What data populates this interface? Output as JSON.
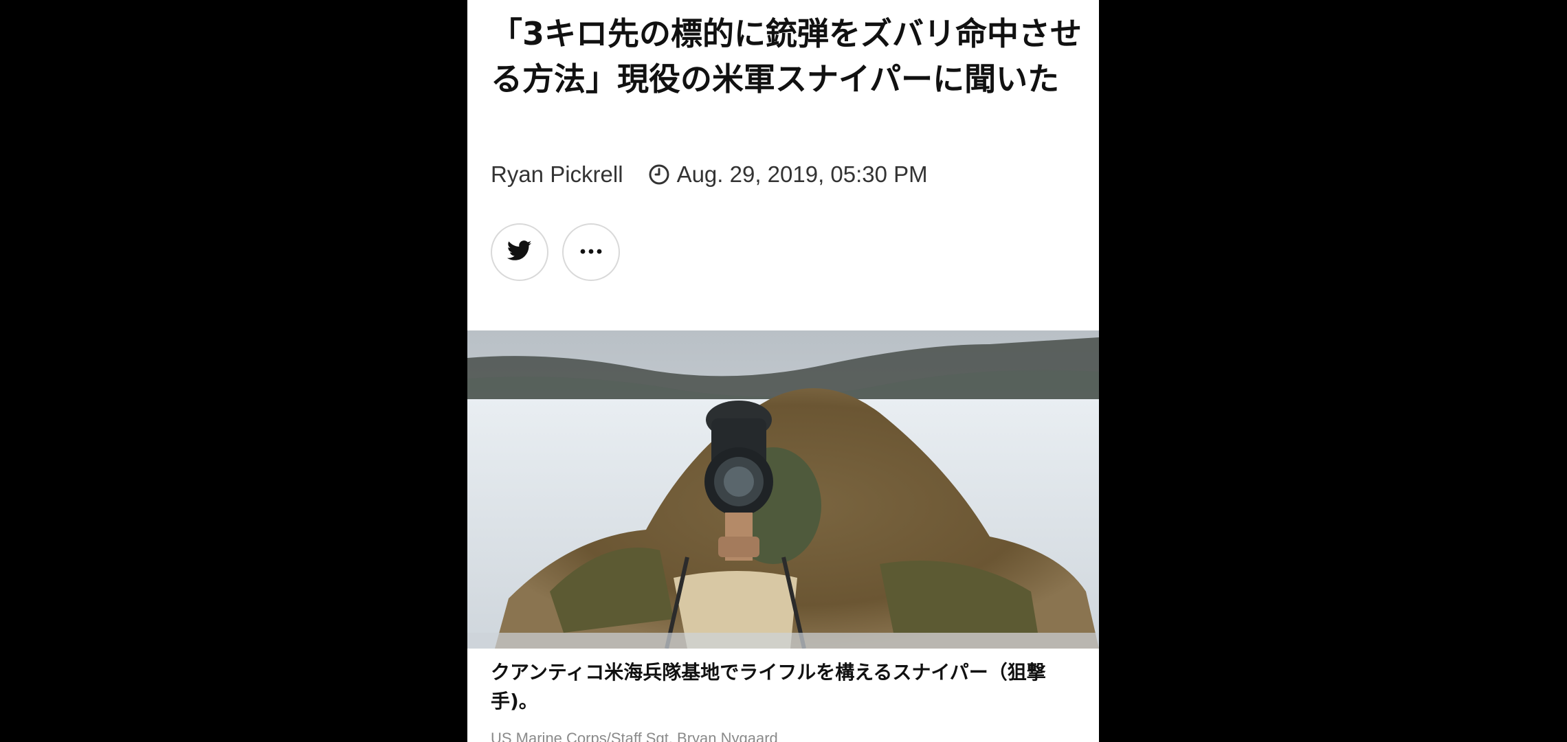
{
  "article": {
    "headline": "「3キロ先の標的に銃弾をズバリ命中させる方法」現役の米軍スナイパーに聞いた",
    "author": "Ryan Pickrell",
    "date": "Aug. 29, 2019, 05:30 PM",
    "share_buttons": [
      {
        "icon": "twitter-icon"
      },
      {
        "icon": "more-horizontal-icon"
      }
    ],
    "image": {
      "caption": "クアンティコ米海兵隊基地でライフルを構えるスナイパー（狙撃手)。",
      "credit": "US Marine Corps/Staff Sgt. Bryan Nygaard"
    }
  },
  "colors": {
    "background": "#000000",
    "column": "#ffffff",
    "text": "#111111",
    "meta_text": "#333333",
    "credit_text": "#8a8a8a",
    "button_border": "#d9d9d9"
  }
}
